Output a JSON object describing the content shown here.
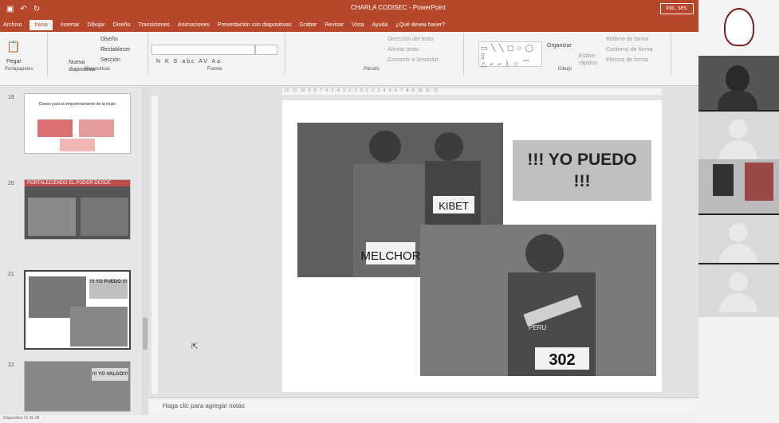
{
  "window": {
    "title": "CHARLA CODISEC - PowerPoint",
    "signin": "Inic. ses."
  },
  "tabs": [
    "Archivo",
    "Inicio",
    "Insertar",
    "Dibujar",
    "Diseño",
    "Transiciones",
    "Animaciones",
    "Presentación con diapositivas",
    "Grabar",
    "Revisar",
    "Vista",
    "Ayuda",
    "¿Qué desea hacer?"
  ],
  "active_tab": "Inicio",
  "ribbon": {
    "clipboard": {
      "label": "Portapapeles",
      "paste": "Pegar"
    },
    "slides": {
      "label": "Diapositivas",
      "new": "Nueva diapositiva",
      "layout": "Diseño",
      "reset": "Restablecer",
      "section": "Sección"
    },
    "font": {
      "label": "Fuente",
      "format_buttons": "N K S abc AV Aa"
    },
    "paragraph": {
      "label": "Párrafo",
      "direction": "Dirección del texto",
      "align": "Alinear texto",
      "smartart": "Convertir a SmartArt"
    },
    "drawing": {
      "label": "Dibujo",
      "organize": "Organizar",
      "quick_styles": "Estilos rápidos",
      "fill": "Relleno de forma",
      "outline": "Contorno de forma",
      "effects": "Efectos de forma"
    }
  },
  "thumbnails": [
    {
      "num": "19",
      "title": "Claves para el empoderamiento de la mujer"
    },
    {
      "num": "20",
      "title": "PORTALECIENDO EL PODER DESDE"
    },
    {
      "num": "21",
      "title": "!!! YO PUEDO !!!"
    },
    {
      "num": "22",
      "title": "!!! YO VALGO!!!"
    }
  ],
  "slide": {
    "heading": "!!! YO PUEDO !!!",
    "bib1": "MELCHOR",
    "bib2": "KIBET",
    "bib3": "302",
    "shirt": "PERU"
  },
  "notes_placeholder": "Haga clic para agregar notas",
  "status": "Diapositiva 21 de 28",
  "colors": {
    "accent": "#b7472a"
  }
}
